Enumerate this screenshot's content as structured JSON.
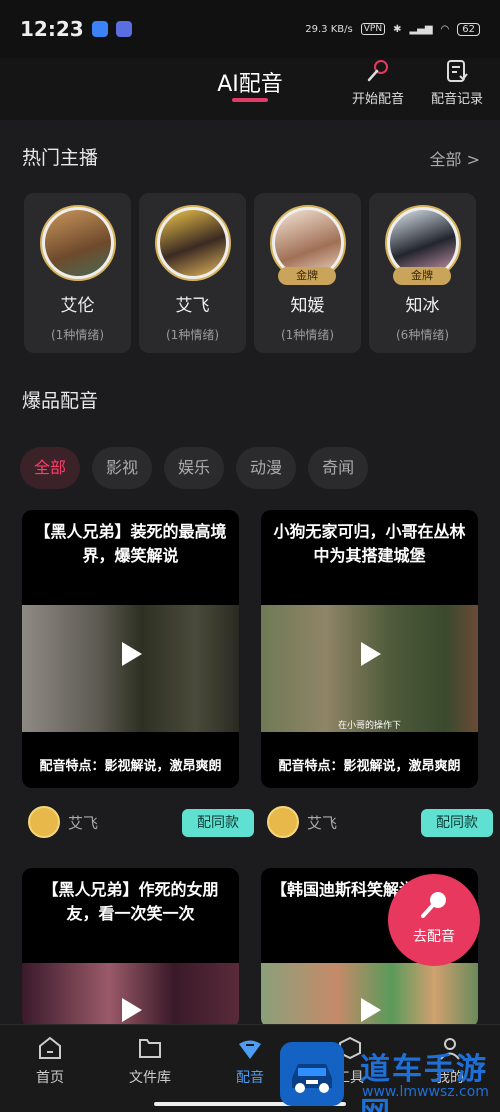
{
  "status_bar": {
    "time": "12:23",
    "net_speed": "29.3 KB/s",
    "vpn": "VPN",
    "battery": "62"
  },
  "header": {
    "title": "AI配音",
    "start_dubbing": "开始配音",
    "dubbing_records": "配音记录"
  },
  "hot_anchors": {
    "title": "热门主播",
    "all": "全部 >",
    "items": [
      {
        "name": "艾伦",
        "emotions": "(1种情绪)",
        "badge": ""
      },
      {
        "name": "艾飞",
        "emotions": "(1种情绪)",
        "badge": ""
      },
      {
        "name": "知媛",
        "emotions": "(1种情绪)",
        "badge": "金牌"
      },
      {
        "name": "知冰",
        "emotions": "(6种情绪)",
        "badge": "金牌"
      }
    ]
  },
  "hits": {
    "title": "爆品配音",
    "categories": [
      "全部",
      "影视",
      "娱乐",
      "动漫",
      "奇闻"
    ],
    "active_category": "全部"
  },
  "cards": [
    {
      "title": "【黑人兄弟】装死的最高境界，爆笑解说",
      "feature": "配音特点：影视解说，激昂爽朗",
      "subtitle": "",
      "author": "艾飞",
      "action": "配同款"
    },
    {
      "title": "小狗无家可归，小哥在丛林中为其搭建城堡",
      "feature": "配音特点：影视解说，激昂爽朗",
      "subtitle": "在小哥的操作下",
      "author": "艾飞",
      "action": "配同款"
    },
    {
      "title": "【黑人兄弟】作死的女朋友，看一次笑一次",
      "feature": "",
      "subtitle": "",
      "author": "",
      "action": ""
    },
    {
      "title": "【韩国迪斯科笑解说",
      "feature": "",
      "subtitle": "",
      "author": "",
      "action": ""
    }
  ],
  "fab": {
    "label": "去配音"
  },
  "nav": {
    "items": [
      "首页",
      "文件库",
      "配音",
      "工具",
      "我的"
    ],
    "active": "配音"
  },
  "watermark": {
    "text": "道车手游网",
    "url": "www.lmwwsz.com"
  },
  "colors": {
    "accent": "#e8385e",
    "nav_active": "#4d9cf5",
    "gold": "#c9a45a",
    "teal_button": "#5fe0d0"
  }
}
